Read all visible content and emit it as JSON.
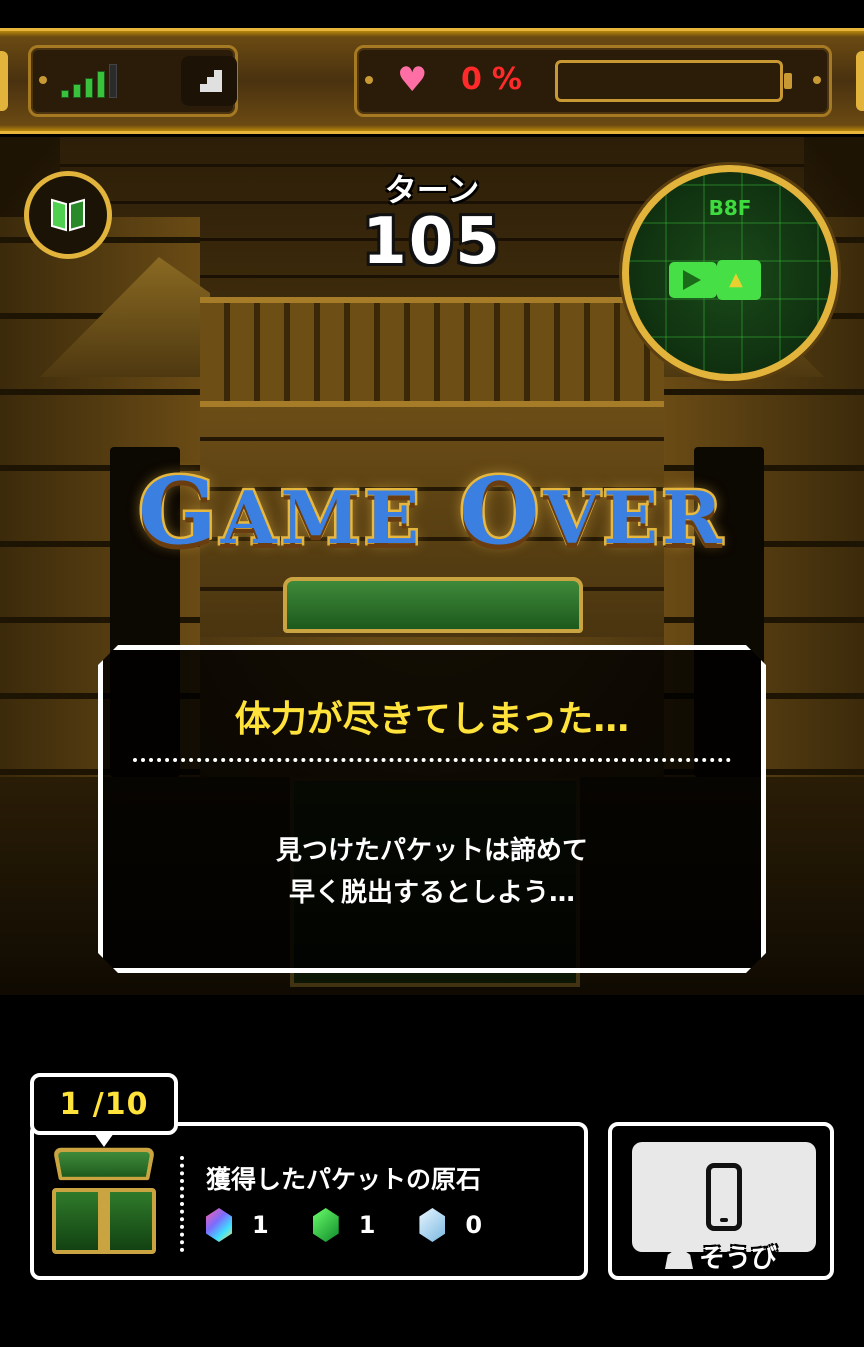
{
  "status_bar": {
    "signal_level": 4,
    "signal_max": 5,
    "hp_percent_text": "0",
    "hp_percent_unit": "%",
    "hp_fill": 0,
    "icons": [
      "signal-bars-icon",
      "stairs-icon",
      "heart-icon"
    ]
  },
  "hud": {
    "turn_label": "ターン",
    "turn_value": "105",
    "minimap_floor": "B8F",
    "book_icon": "guide-book-icon"
  },
  "banner": {
    "game_over_g": "G",
    "game_over_ame": "AME",
    "game_over_o": "O",
    "game_over_ver": "VER"
  },
  "dialog": {
    "title": "体力が尽きてしまった…",
    "line1": "見つけたパケットは諦めて",
    "line2": "早く脱出するとしよう…"
  },
  "inventory": {
    "counter": "1 /10",
    "title": "獲得したパケットの原石",
    "gems": [
      {
        "name": "rainbow-gem-icon",
        "count": "1"
      },
      {
        "name": "green-gem-icon",
        "count": "1"
      },
      {
        "name": "ice-gem-icon",
        "count": "0"
      }
    ]
  },
  "equip": {
    "label": "そうび",
    "icon": "smartphone-icon"
  },
  "colors": {
    "gold": "#e2b43c",
    "hp_text": "#ff2a2a",
    "dialog_title": "#ffe23a",
    "minimap_green": "#46e046",
    "game_over_blue": "#3b7fe0"
  }
}
